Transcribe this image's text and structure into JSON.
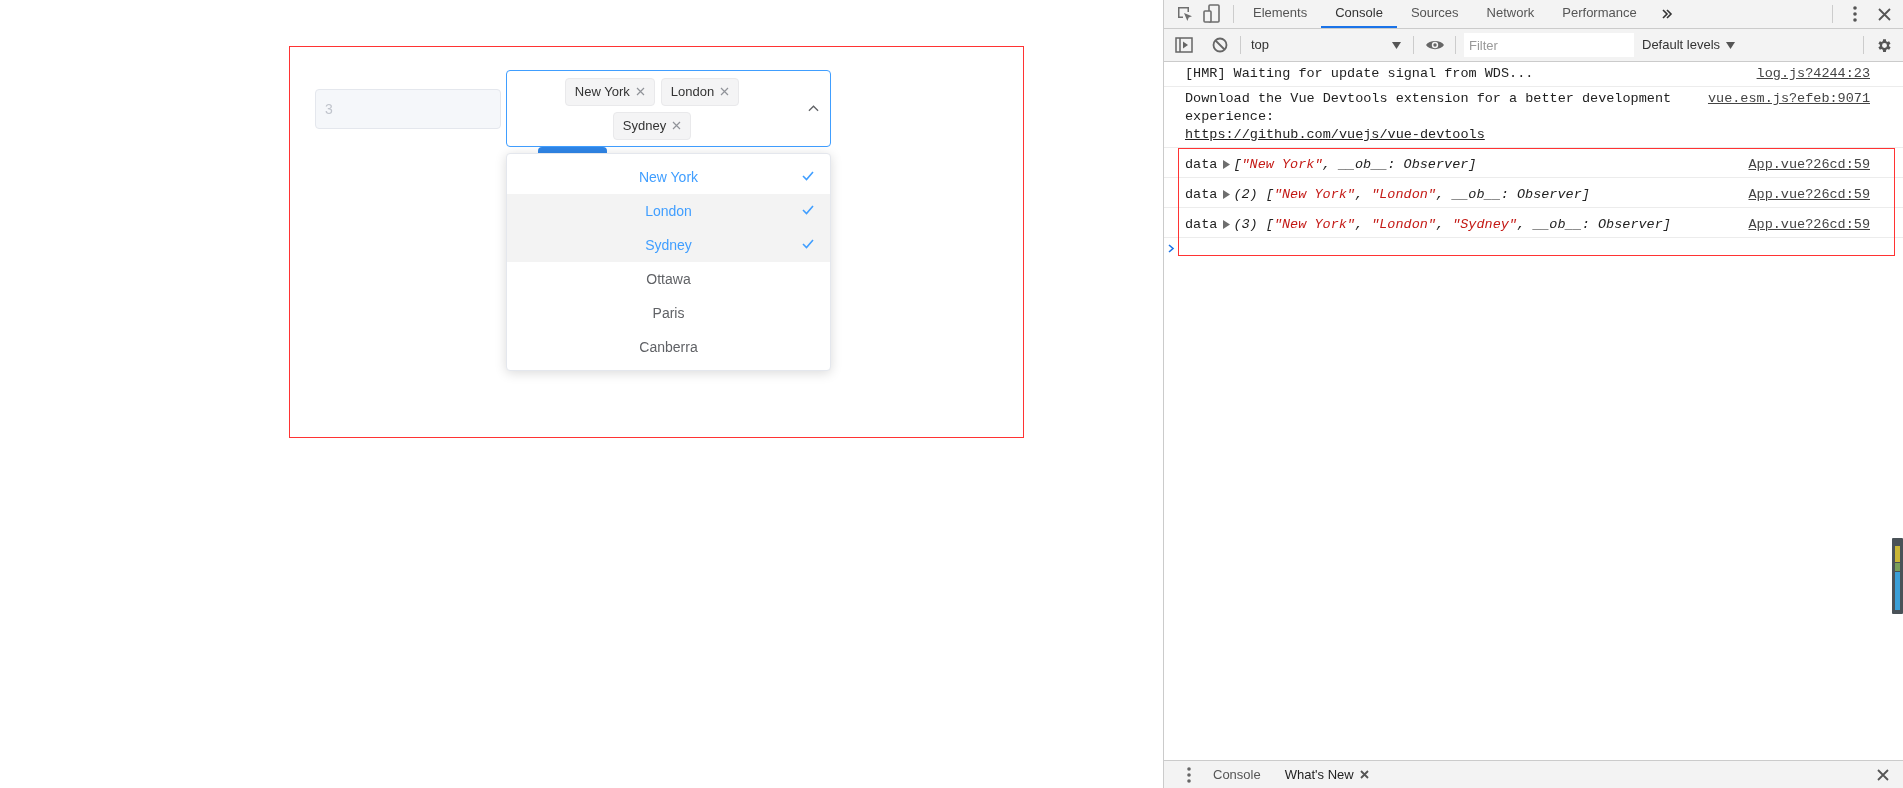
{
  "page": {
    "number_input": {
      "value": "3",
      "disabled": true
    },
    "select": {
      "expanded": true,
      "tags": [
        {
          "label": "New York"
        },
        {
          "label": "London"
        },
        {
          "label": "Sydney"
        }
      ]
    },
    "options": [
      {
        "label": "New York",
        "selected": true,
        "highlighted": false
      },
      {
        "label": "London",
        "selected": true,
        "highlighted": true
      },
      {
        "label": "Sydney",
        "selected": true,
        "highlighted": true
      },
      {
        "label": "Ottawa",
        "selected": false,
        "highlighted": false
      },
      {
        "label": "Paris",
        "selected": false,
        "highlighted": false
      },
      {
        "label": "Canberra",
        "selected": false,
        "highlighted": false
      }
    ]
  },
  "devtools": {
    "tabs": [
      {
        "label": "Elements",
        "selected": false
      },
      {
        "label": "Console",
        "selected": true
      },
      {
        "label": "Sources",
        "selected": false
      },
      {
        "label": "Network",
        "selected": false
      },
      {
        "label": "Performance",
        "selected": false
      }
    ],
    "context": "top",
    "filter_placeholder": "Filter",
    "levels": "Default levels",
    "messages": [
      {
        "kind": "text",
        "text": "[HMR] Waiting for update signal from WDS...",
        "source": "log.js?4244:23"
      },
      {
        "kind": "text",
        "text": "Download the Vue Devtools extension for a better development experience:",
        "link": "https://github.com/vuejs/vue-devtools",
        "source": "vue.esm.js?efeb:9071"
      },
      {
        "kind": "object",
        "label": "data",
        "parts": [
          {
            "text": "[",
            "kind": "plain"
          },
          {
            "text": "\"New York\"",
            "kind": "string"
          },
          {
            "text": ", __ob__: Observer]",
            "kind": "plain"
          }
        ],
        "source": "App.vue?26cd:59"
      },
      {
        "kind": "object",
        "label": "data",
        "count": "(2)",
        "parts": [
          {
            "text": "[",
            "kind": "plain"
          },
          {
            "text": "\"New York\"",
            "kind": "string"
          },
          {
            "text": ", ",
            "kind": "plain"
          },
          {
            "text": "\"London\"",
            "kind": "string"
          },
          {
            "text": ", __ob__: Observer]",
            "kind": "plain"
          }
        ],
        "source": "App.vue?26cd:59"
      },
      {
        "kind": "object",
        "label": "data",
        "count": "(3)",
        "parts": [
          {
            "text": "[",
            "kind": "plain"
          },
          {
            "text": "\"New York\"",
            "kind": "string"
          },
          {
            "text": ", ",
            "kind": "plain"
          },
          {
            "text": "\"London\"",
            "kind": "string"
          },
          {
            "text": ", ",
            "kind": "plain"
          },
          {
            "text": "\"Sydney\"",
            "kind": "string"
          },
          {
            "text": ", __ob__: Observer]",
            "kind": "plain"
          }
        ],
        "source": "App.vue?26cd:59"
      }
    ],
    "drawer_tabs": [
      {
        "label": "Console",
        "selected": false,
        "closable": false
      },
      {
        "label": "What's New",
        "selected": true,
        "closable": true
      }
    ]
  }
}
